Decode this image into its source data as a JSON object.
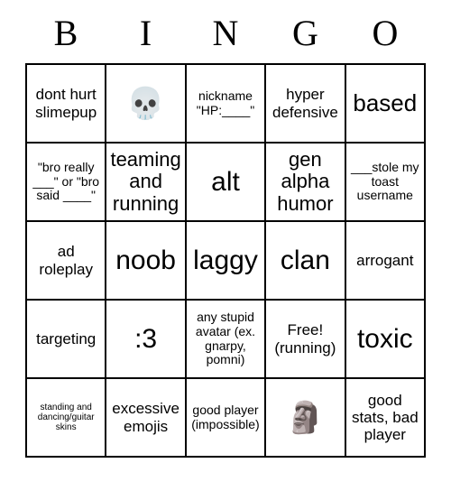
{
  "card": {
    "title_letters": [
      "B",
      "I",
      "N",
      "G",
      "O"
    ],
    "rows": [
      [
        {
          "text": "dont hurt slimepup",
          "size": "s-md",
          "kind": "text"
        },
        {
          "text": "💀",
          "size": "emoji",
          "kind": "emoji",
          "icon": "skull-emoji"
        },
        {
          "text": "nickname \"HP:____\"",
          "size": "s-sm",
          "kind": "text"
        },
        {
          "text": "hyper defensive",
          "size": "s-md",
          "kind": "text"
        },
        {
          "text": "based",
          "size": "s-xl",
          "kind": "text"
        }
      ],
      [
        {
          "text": "\"bro really ___\" or \"bro said ____\"",
          "size": "s-sm",
          "kind": "text"
        },
        {
          "text": "teaming and running",
          "size": "s-lg",
          "kind": "text"
        },
        {
          "text": "alt",
          "size": "s-xxl",
          "kind": "text"
        },
        {
          "text": "gen alpha humor",
          "size": "s-lg",
          "kind": "text"
        },
        {
          "text": "___stole my toast username",
          "size": "s-sm",
          "kind": "text"
        }
      ],
      [
        {
          "text": "ad roleplay",
          "size": "s-md",
          "kind": "text"
        },
        {
          "text": "noob",
          "size": "s-xxl",
          "kind": "text"
        },
        {
          "text": "laggy",
          "size": "s-xxl",
          "kind": "text"
        },
        {
          "text": "clan",
          "size": "s-xxl",
          "kind": "text"
        },
        {
          "text": "arrogant",
          "size": "s-md",
          "kind": "text"
        }
      ],
      [
        {
          "text": "targeting",
          "size": "s-md",
          "kind": "text"
        },
        {
          "text": ":3",
          "size": "s-xxl",
          "kind": "text"
        },
        {
          "text": "any stupid avatar (ex. gnarpy, pomni)",
          "size": "s-sm",
          "kind": "text"
        },
        {
          "text": "Free! (running)",
          "size": "s-md",
          "kind": "text"
        },
        {
          "text": "toxic",
          "size": "s-xxl",
          "kind": "text"
        }
      ],
      [
        {
          "text": "standing and dancing/guitar skins",
          "size": "s-xxs",
          "kind": "text"
        },
        {
          "text": "excessive emojis",
          "size": "s-md",
          "kind": "text"
        },
        {
          "text": "good player (impossible)",
          "size": "s-sm",
          "kind": "text"
        },
        {
          "text": "🗿",
          "size": "emoji",
          "kind": "emoji",
          "icon": "moai-emoji"
        },
        {
          "text": "good stats, bad player",
          "size": "s-md",
          "kind": "text"
        }
      ]
    ]
  },
  "colors": {
    "border": "#000000",
    "background": "#ffffff",
    "text": "#000000"
  }
}
